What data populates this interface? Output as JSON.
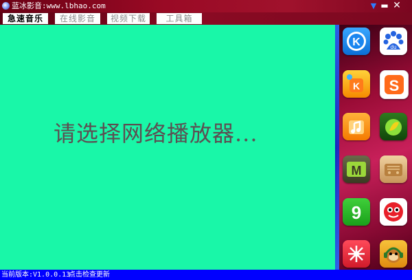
{
  "window": {
    "title": "蓝冰影音:www.lbhao.com",
    "close_glyph": "✕",
    "minimize_glyph": "▬",
    "dropdown_glyph": "▼"
  },
  "tabs": [
    {
      "label": "急速音乐",
      "active": true
    },
    {
      "label": "在线影音",
      "active": false
    },
    {
      "label": "视频下载",
      "active": false
    },
    {
      "label": "工具箱",
      "active": false
    }
  ],
  "main": {
    "background": "#19f7a8",
    "prompt": "请选择网络播放器..."
  },
  "sidebar": {
    "apps": [
      {
        "icon": "kugou-icon"
      },
      {
        "icon": "baidu-music-icon"
      },
      {
        "icon": "kuwo-icon"
      },
      {
        "icon": "s-music-icon"
      },
      {
        "icon": "orange-music-icon"
      },
      {
        "icon": "green-leaf-icon"
      },
      {
        "icon": "m-tv-icon"
      },
      {
        "icon": "radio-icon"
      },
      {
        "icon": "nine-icon"
      },
      {
        "icon": "red-mascot-icon"
      },
      {
        "icon": "snowflake-icon"
      },
      {
        "icon": "monkey-headphones-icon"
      }
    ]
  },
  "status": {
    "version": "当前版本:V1.0.0.13",
    "update_link": "点击检查更新",
    "background": "#0000ff"
  }
}
